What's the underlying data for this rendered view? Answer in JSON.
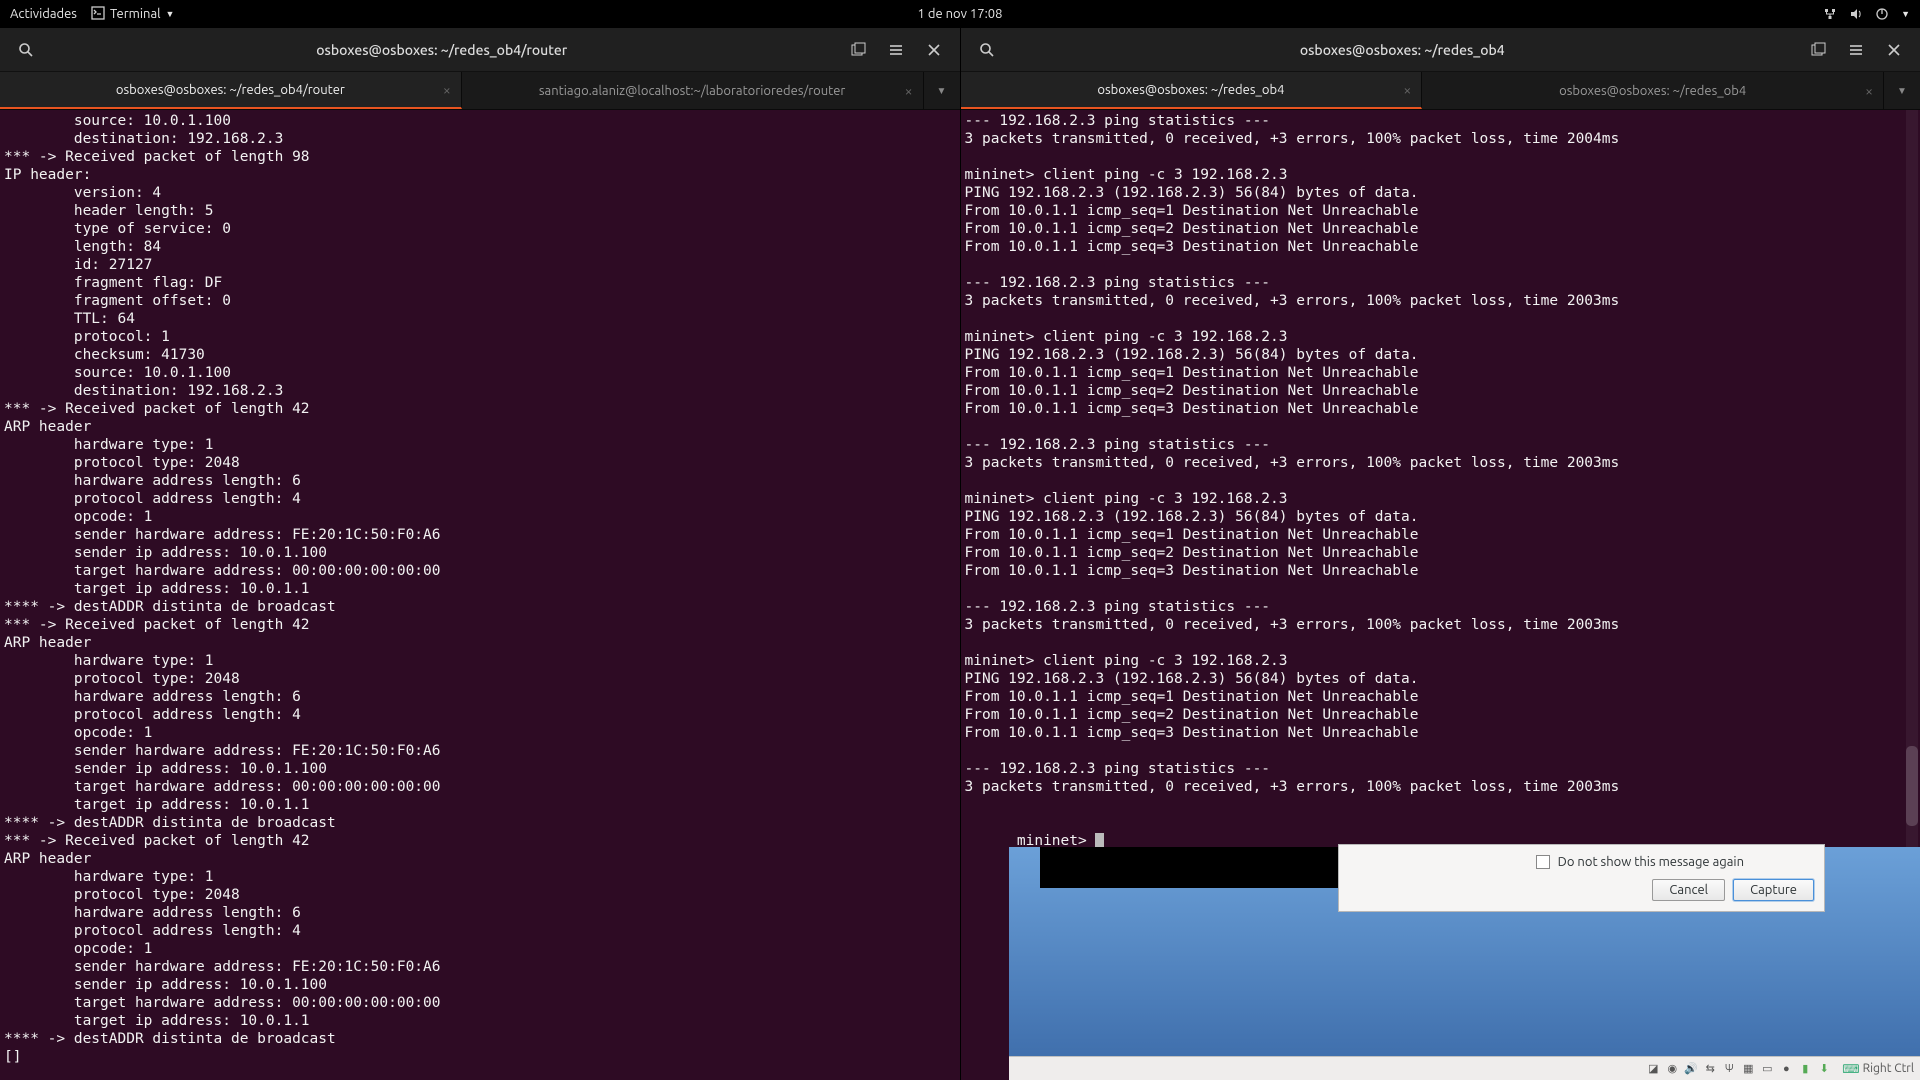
{
  "topbar": {
    "activities": "Actividades",
    "app_name": "Terminal",
    "datetime": "1 de nov  17:08"
  },
  "left_window": {
    "title": "osboxes@osboxes: ~/redes_ob4/router",
    "tabs": [
      {
        "label": "osboxes@osboxes: ~/redes_ob4/router",
        "active": true
      },
      {
        "label": "santiago.alaniz@localhost:~/laboratorioredes/router",
        "active": false
      }
    ],
    "terminal_lines": [
      "        source: 10.0.1.100",
      "        destination: 192.168.2.3",
      "*** -> Received packet of length 98",
      "IP header:",
      "        version: 4",
      "        header length: 5",
      "        type of service: 0",
      "        length: 84",
      "        id: 27127",
      "        fragment flag: DF",
      "        fragment offset: 0",
      "        TTL: 64",
      "        protocol: 1",
      "        checksum: 41730",
      "        source: 10.0.1.100",
      "        destination: 192.168.2.3",
      "*** -> Received packet of length 42",
      "ARP header",
      "        hardware type: 1",
      "        protocol type: 2048",
      "        hardware address length: 6",
      "        protocol address length: 4",
      "        opcode: 1",
      "        sender hardware address: FE:20:1C:50:F0:A6",
      "        sender ip address: 10.0.1.100",
      "        target hardware address: 00:00:00:00:00:00",
      "        target ip address: 10.0.1.1",
      "**** -> destADDR distinta de broadcast",
      "*** -> Received packet of length 42",
      "ARP header",
      "        hardware type: 1",
      "        protocol type: 2048",
      "        hardware address length: 6",
      "        protocol address length: 4",
      "        opcode: 1",
      "        sender hardware address: FE:20:1C:50:F0:A6",
      "        sender ip address: 10.0.1.100",
      "        target hardware address: 00:00:00:00:00:00",
      "        target ip address: 10.0.1.1",
      "**** -> destADDR distinta de broadcast",
      "*** -> Received packet of length 42",
      "ARP header",
      "        hardware type: 1",
      "        protocol type: 2048",
      "        hardware address length: 6",
      "        protocol address length: 4",
      "        opcode: 1",
      "        sender hardware address: FE:20:1C:50:F0:A6",
      "        sender ip address: 10.0.1.100",
      "        target hardware address: 00:00:00:00:00:00",
      "        target ip address: 10.0.1.1",
      "**** -> destADDR distinta de broadcast",
      "[]"
    ]
  },
  "right_window": {
    "title": "osboxes@osboxes: ~/redes_ob4",
    "tabs": [
      {
        "label": "osboxes@osboxes: ~/redes_ob4",
        "active": true
      },
      {
        "label": "osboxes@osboxes: ~/redes_ob4",
        "active": false
      }
    ],
    "terminal_lines": [
      "--- 192.168.2.3 ping statistics ---",
      "3 packets transmitted, 0 received, +3 errors, 100% packet loss, time 2004ms",
      "",
      "mininet> client ping -c 3 192.168.2.3",
      "PING 192.168.2.3 (192.168.2.3) 56(84) bytes of data.",
      "From 10.0.1.1 icmp_seq=1 Destination Net Unreachable",
      "From 10.0.1.1 icmp_seq=2 Destination Net Unreachable",
      "From 10.0.1.1 icmp_seq=3 Destination Net Unreachable",
      "",
      "--- 192.168.2.3 ping statistics ---",
      "3 packets transmitted, 0 received, +3 errors, 100% packet loss, time 2003ms",
      "",
      "mininet> client ping -c 3 192.168.2.3",
      "PING 192.168.2.3 (192.168.2.3) 56(84) bytes of data.",
      "From 10.0.1.1 icmp_seq=1 Destination Net Unreachable",
      "From 10.0.1.1 icmp_seq=2 Destination Net Unreachable",
      "From 10.0.1.1 icmp_seq=3 Destination Net Unreachable",
      "",
      "--- 192.168.2.3 ping statistics ---",
      "3 packets transmitted, 0 received, +3 errors, 100% packet loss, time 2003ms",
      "",
      "mininet> client ping -c 3 192.168.2.3",
      "PING 192.168.2.3 (192.168.2.3) 56(84) bytes of data.",
      "From 10.0.1.1 icmp_seq=1 Destination Net Unreachable",
      "From 10.0.1.1 icmp_seq=2 Destination Net Unreachable",
      "From 10.0.1.1 icmp_seq=3 Destination Net Unreachable",
      "",
      "--- 192.168.2.3 ping statistics ---",
      "3 packets transmitted, 0 received, +3 errors, 100% packet loss, time 2003ms",
      "",
      "mininet> client ping -c 3 192.168.2.3",
      "PING 192.168.2.3 (192.168.2.3) 56(84) bytes of data.",
      "From 10.0.1.1 icmp_seq=1 Destination Net Unreachable",
      "From 10.0.1.1 icmp_seq=2 Destination Net Unreachable",
      "From 10.0.1.1 icmp_seq=3 Destination Net Unreachable",
      "",
      "--- 192.168.2.3 ping statistics ---",
      "3 packets transmitted, 0 received, +3 errors, 100% packet loss, time 2003ms",
      "",
      "mininet> "
    ]
  },
  "dialog": {
    "checkbox_label": "Do not show this message again",
    "cancel_label": "Cancel",
    "capture_label": "Capture"
  },
  "vm_bar": {
    "host_key": "Right Ctrl"
  }
}
